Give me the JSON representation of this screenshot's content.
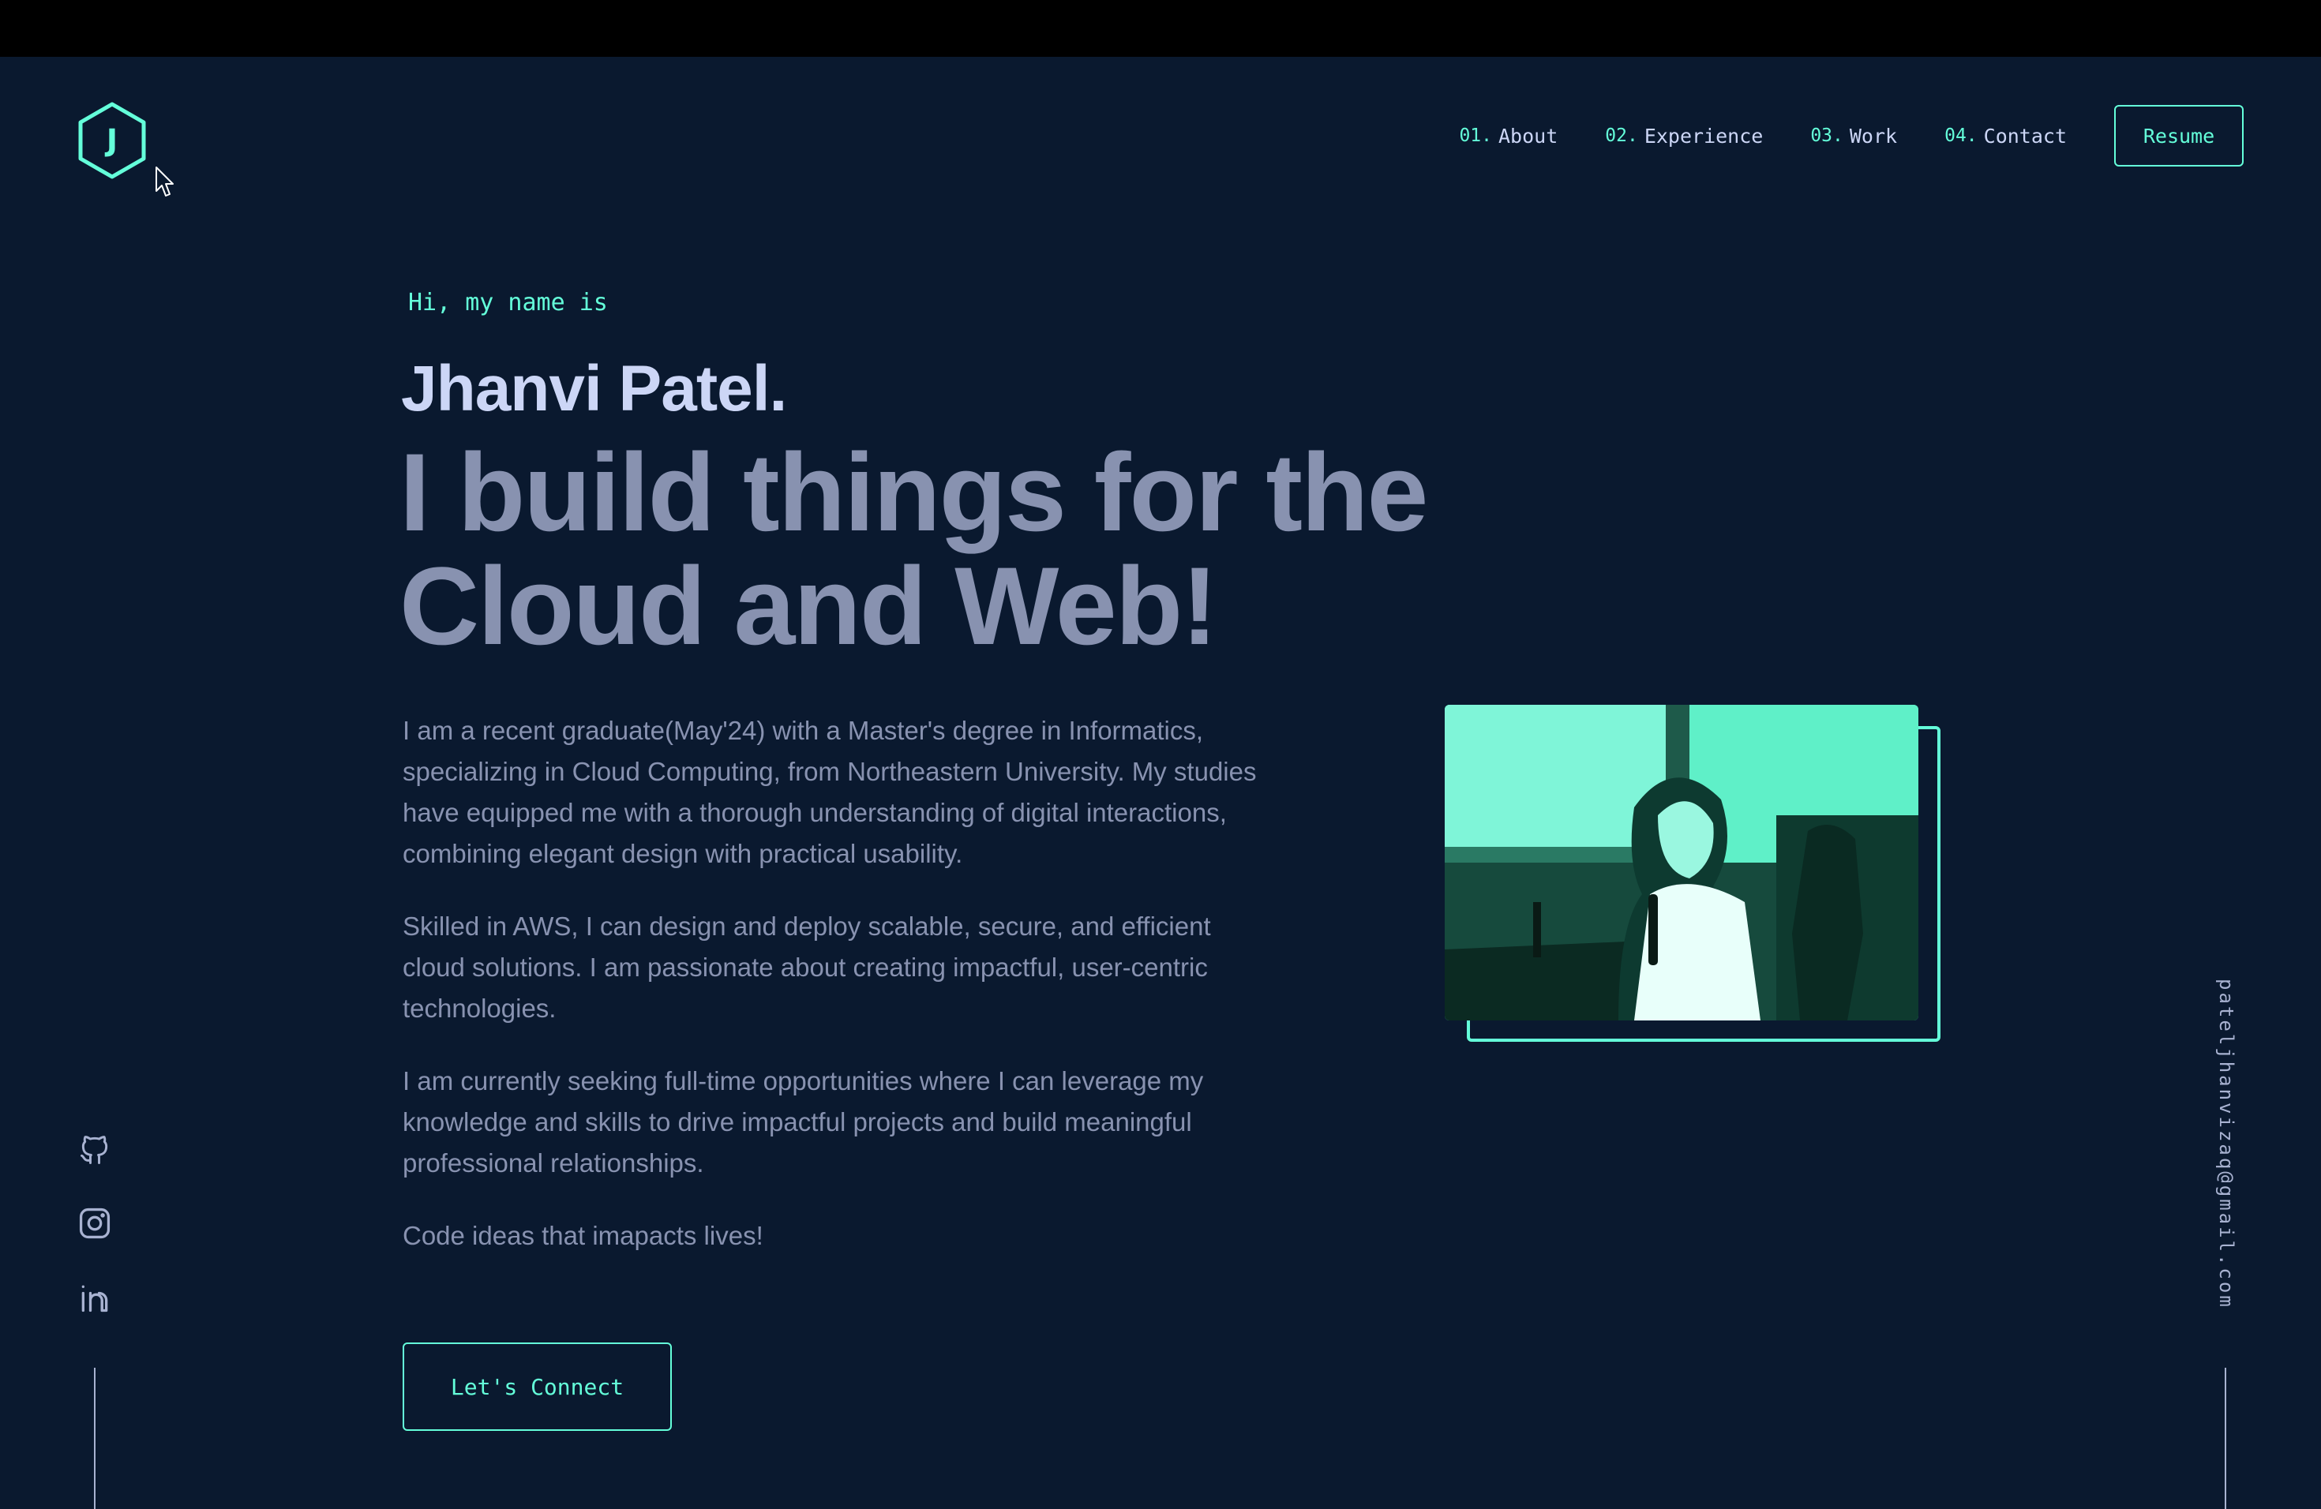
{
  "logo": {
    "letter": "J",
    "icon": "hexagon-icon"
  },
  "nav": {
    "items": [
      {
        "num": "01.",
        "label": "About"
      },
      {
        "num": "02.",
        "label": "Experience"
      },
      {
        "num": "03.",
        "label": "Work"
      },
      {
        "num": "04.",
        "label": "Contact"
      }
    ],
    "resume_label": "Resume"
  },
  "hero": {
    "greeting": "Hi, my name is",
    "name": "Jhanvi Patel.",
    "tagline": "I build things for the Cloud and Web!",
    "bio": [
      "I am a recent graduate(May'24) with a Master's degree in Informatics, specializing in Cloud Computing, from Northeastern University. My studies have equipped me with a thorough understanding of digital interactions, combining elegant design with practical usability.",
      "Skilled in AWS, I can design and deploy scalable, secure, and efficient cloud solutions. I am passionate about creating impactful, user-centric technologies.",
      "I am currently seeking full-time opportunities where I can leverage my knowledge and skills to drive impactful projects and build meaningful professional relationships.",
      "Code ideas that imapacts lives!"
    ],
    "cta_label": "Let's Connect"
  },
  "socials": [
    {
      "icon": "github-icon"
    },
    {
      "icon": "instagram-icon"
    },
    {
      "icon": "linkedin-icon"
    }
  ],
  "email": "pateljhanvizaq@gmail.com",
  "colors": {
    "background": "#0a192f",
    "accent": "#64ffda",
    "heading": "#ccd6f6",
    "body": "#8892b0",
    "topbar": "#000000"
  }
}
